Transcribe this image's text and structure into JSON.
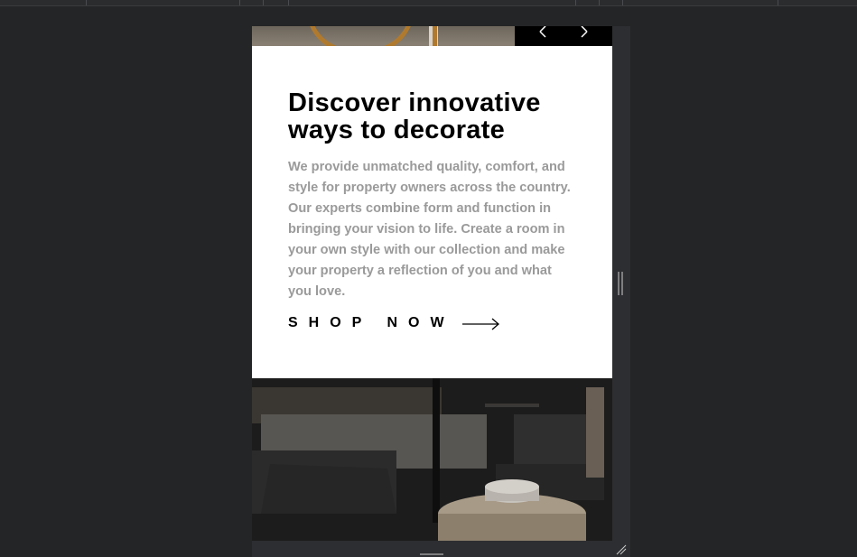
{
  "card": {
    "title": "Discover innovative ways to decorate",
    "description": "We provide unmatched quality, comfort, and style for property owners across the country. Our experts combine form and function in bringing your vision to life. Create a room in your own style with our collection and make your property a reflection of you and what you love.",
    "cta_label": "SHOP NOW"
  },
  "icons": {
    "prev": "angle-left-icon",
    "next": "angle-right-icon",
    "cta_arrow": "arrow-right-icon",
    "resize_right": "resize-handle-vertical-icon",
    "resize_bottom": "resize-handle-horizontal-icon",
    "resize_corner": "resize-corner-icon"
  },
  "colors": {
    "page_background": "#242526",
    "card_background": "#ffffff",
    "title": "#000000",
    "description": "#9a9a9a",
    "nav_background": "#000000"
  }
}
